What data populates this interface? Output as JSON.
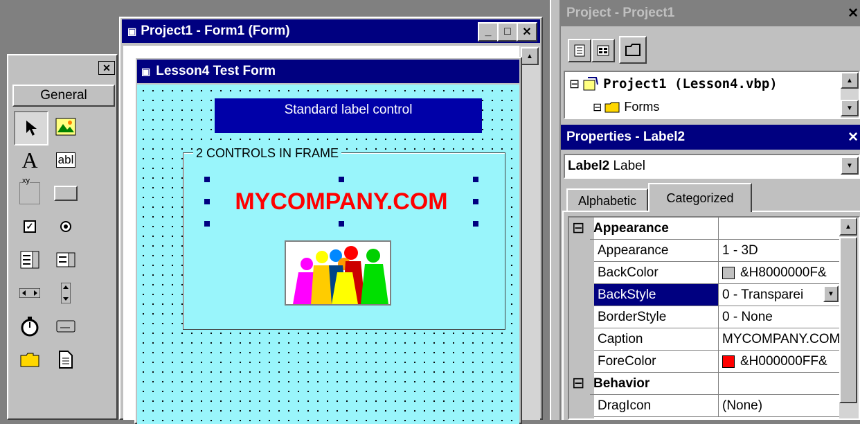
{
  "form_window": {
    "title": "Project1 - Form1 (Form)"
  },
  "form": {
    "caption": "Lesson4 Test Form",
    "label1": "Standard label control",
    "frame_caption": "2 CONTROLS IN FRAME",
    "label2": "MYCOMPANY.COM"
  },
  "toolbox": {
    "tab": "General",
    "text_label_glyph": "A",
    "textbox_glyph": "abl",
    "frame_glyph": "xy"
  },
  "project": {
    "title": "Project - Project1",
    "root": "Project1 (Lesson4.vbp)",
    "forms_folder": "Forms"
  },
  "properties": {
    "title": "Properties - Label2",
    "object_name": "Label2",
    "object_type": "Label",
    "tabs": [
      "Alphabetic",
      "Categorized"
    ],
    "rows": [
      {
        "kind": "category",
        "name": "Appearance",
        "sign": "⊟"
      },
      {
        "kind": "prop",
        "name": "Appearance",
        "value": "1 - 3D"
      },
      {
        "kind": "prop",
        "name": "BackColor",
        "value": "&H8000000F&",
        "swatch": "#c0c0c0"
      },
      {
        "kind": "prop",
        "name": "BackStyle",
        "value": "0 - Transparei",
        "selected": true,
        "dropdown": true
      },
      {
        "kind": "prop",
        "name": "BorderStyle",
        "value": "0 - None"
      },
      {
        "kind": "prop",
        "name": "Caption",
        "value": "MYCOMPANY.COM"
      },
      {
        "kind": "prop",
        "name": "ForeColor",
        "value": "&H000000FF&",
        "swatch": "#ff0000"
      },
      {
        "kind": "category",
        "name": "Behavior",
        "sign": "⊟"
      },
      {
        "kind": "prop",
        "name": "DragIcon",
        "value": "(None)"
      }
    ]
  },
  "colors": {
    "selection": "#000080",
    "form_back": "#99f5fb",
    "label_red": "#ff0000"
  }
}
